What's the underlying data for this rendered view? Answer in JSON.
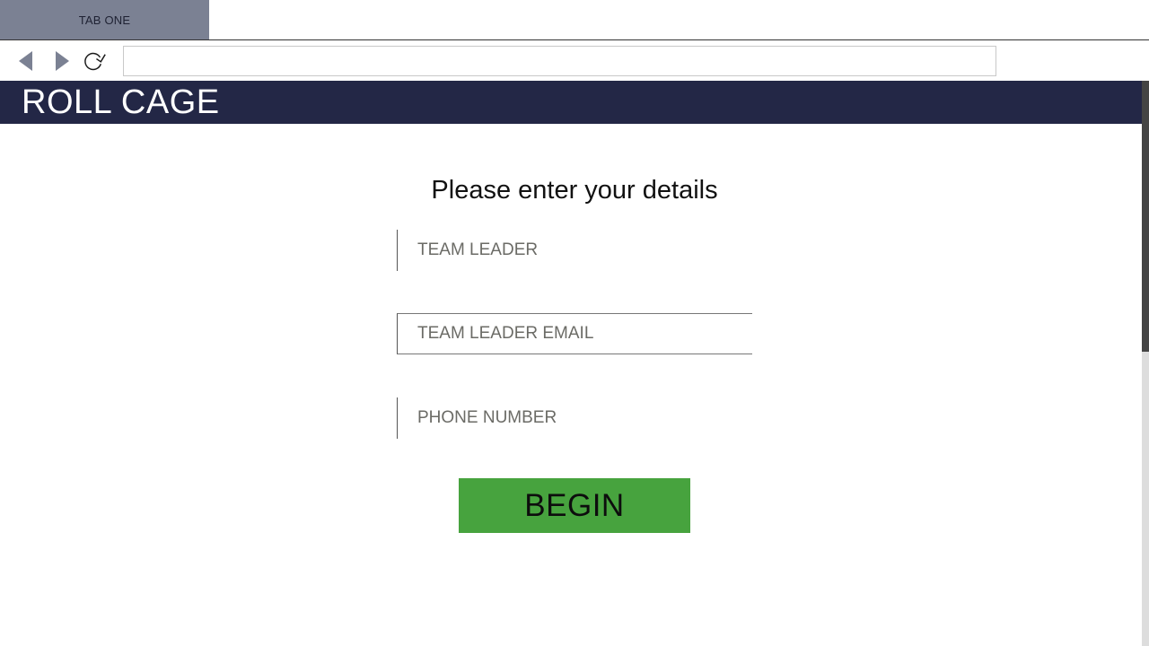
{
  "browser": {
    "tabs": [
      {
        "label": "TAB ONE"
      }
    ],
    "address_value": "",
    "icons": {
      "back": "back-arrow-icon",
      "forward": "forward-arrow-icon",
      "reload": "reload-icon"
    }
  },
  "header": {
    "brand": "ROLL CAGE"
  },
  "form": {
    "title": "Please enter your details",
    "fields": [
      {
        "placeholder": "TEAM LEADER"
      },
      {
        "placeholder": "TEAM LEADER EMAIL"
      },
      {
        "placeholder": "PHONE NUMBER"
      }
    ],
    "submit_label": "BEGIN"
  },
  "colors": {
    "tab_active": "#7b8193",
    "header_bg": "#232746",
    "button_bg": "#47a33e",
    "nav_icon": "#7b8193"
  }
}
